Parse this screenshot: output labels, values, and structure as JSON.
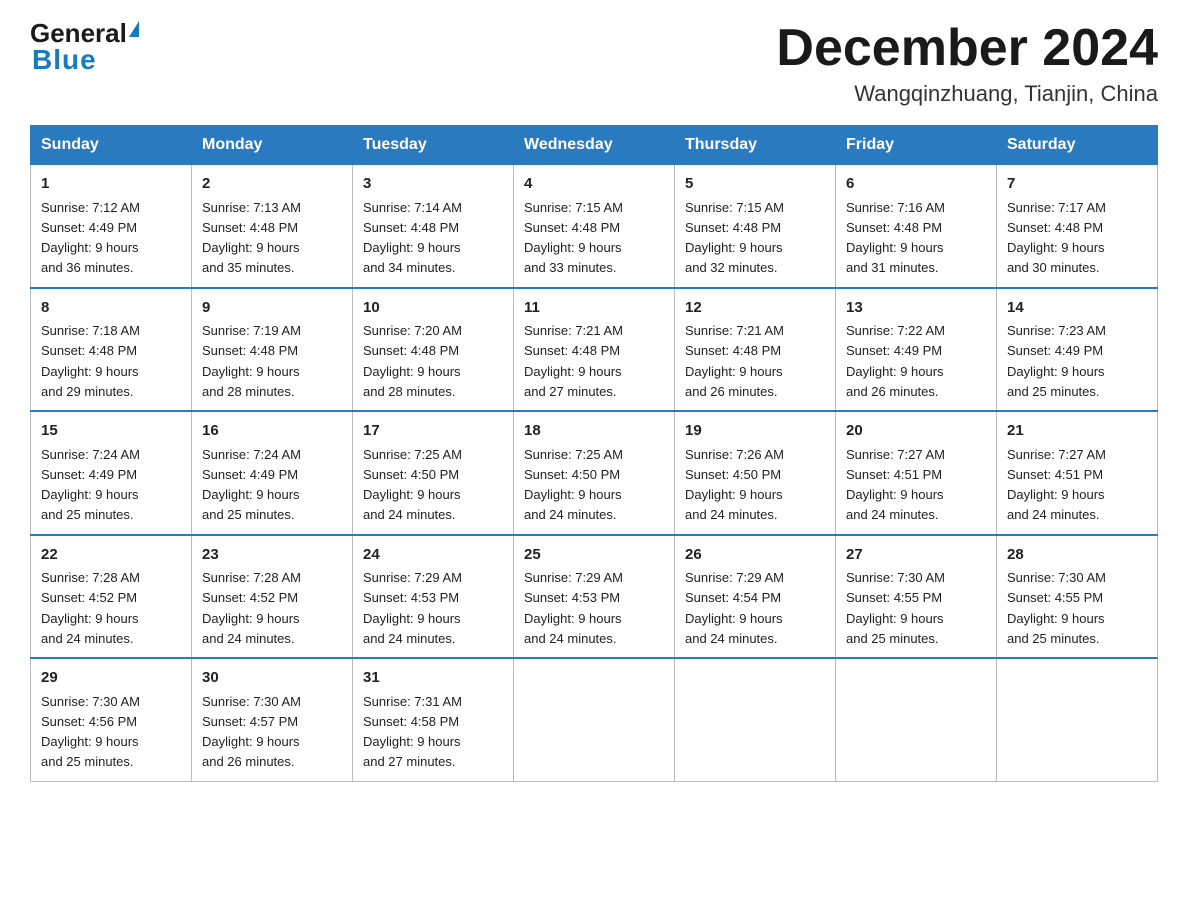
{
  "logo": {
    "general": "General",
    "triangle": "▶",
    "blue": "Blue"
  },
  "title": {
    "month": "December 2024",
    "location": "Wangqinzhuang, Tianjin, China"
  },
  "weekdays": [
    "Sunday",
    "Monday",
    "Tuesday",
    "Wednesday",
    "Thursday",
    "Friday",
    "Saturday"
  ],
  "weeks": [
    [
      {
        "day": "1",
        "sunrise": "7:12 AM",
        "sunset": "4:49 PM",
        "daylight": "9 hours and 36 minutes."
      },
      {
        "day": "2",
        "sunrise": "7:13 AM",
        "sunset": "4:48 PM",
        "daylight": "9 hours and 35 minutes."
      },
      {
        "day": "3",
        "sunrise": "7:14 AM",
        "sunset": "4:48 PM",
        "daylight": "9 hours and 34 minutes."
      },
      {
        "day": "4",
        "sunrise": "7:15 AM",
        "sunset": "4:48 PM",
        "daylight": "9 hours and 33 minutes."
      },
      {
        "day": "5",
        "sunrise": "7:15 AM",
        "sunset": "4:48 PM",
        "daylight": "9 hours and 32 minutes."
      },
      {
        "day": "6",
        "sunrise": "7:16 AM",
        "sunset": "4:48 PM",
        "daylight": "9 hours and 31 minutes."
      },
      {
        "day": "7",
        "sunrise": "7:17 AM",
        "sunset": "4:48 PM",
        "daylight": "9 hours and 30 minutes."
      }
    ],
    [
      {
        "day": "8",
        "sunrise": "7:18 AM",
        "sunset": "4:48 PM",
        "daylight": "9 hours and 29 minutes."
      },
      {
        "day": "9",
        "sunrise": "7:19 AM",
        "sunset": "4:48 PM",
        "daylight": "9 hours and 28 minutes."
      },
      {
        "day": "10",
        "sunrise": "7:20 AM",
        "sunset": "4:48 PM",
        "daylight": "9 hours and 28 minutes."
      },
      {
        "day": "11",
        "sunrise": "7:21 AM",
        "sunset": "4:48 PM",
        "daylight": "9 hours and 27 minutes."
      },
      {
        "day": "12",
        "sunrise": "7:21 AM",
        "sunset": "4:48 PM",
        "daylight": "9 hours and 26 minutes."
      },
      {
        "day": "13",
        "sunrise": "7:22 AM",
        "sunset": "4:49 PM",
        "daylight": "9 hours and 26 minutes."
      },
      {
        "day": "14",
        "sunrise": "7:23 AM",
        "sunset": "4:49 PM",
        "daylight": "9 hours and 25 minutes."
      }
    ],
    [
      {
        "day": "15",
        "sunrise": "7:24 AM",
        "sunset": "4:49 PM",
        "daylight": "9 hours and 25 minutes."
      },
      {
        "day": "16",
        "sunrise": "7:24 AM",
        "sunset": "4:49 PM",
        "daylight": "9 hours and 25 minutes."
      },
      {
        "day": "17",
        "sunrise": "7:25 AM",
        "sunset": "4:50 PM",
        "daylight": "9 hours and 24 minutes."
      },
      {
        "day": "18",
        "sunrise": "7:25 AM",
        "sunset": "4:50 PM",
        "daylight": "9 hours and 24 minutes."
      },
      {
        "day": "19",
        "sunrise": "7:26 AM",
        "sunset": "4:50 PM",
        "daylight": "9 hours and 24 minutes."
      },
      {
        "day": "20",
        "sunrise": "7:27 AM",
        "sunset": "4:51 PM",
        "daylight": "9 hours and 24 minutes."
      },
      {
        "day": "21",
        "sunrise": "7:27 AM",
        "sunset": "4:51 PM",
        "daylight": "9 hours and 24 minutes."
      }
    ],
    [
      {
        "day": "22",
        "sunrise": "7:28 AM",
        "sunset": "4:52 PM",
        "daylight": "9 hours and 24 minutes."
      },
      {
        "day": "23",
        "sunrise": "7:28 AM",
        "sunset": "4:52 PM",
        "daylight": "9 hours and 24 minutes."
      },
      {
        "day": "24",
        "sunrise": "7:29 AM",
        "sunset": "4:53 PM",
        "daylight": "9 hours and 24 minutes."
      },
      {
        "day": "25",
        "sunrise": "7:29 AM",
        "sunset": "4:53 PM",
        "daylight": "9 hours and 24 minutes."
      },
      {
        "day": "26",
        "sunrise": "7:29 AM",
        "sunset": "4:54 PM",
        "daylight": "9 hours and 24 minutes."
      },
      {
        "day": "27",
        "sunrise": "7:30 AM",
        "sunset": "4:55 PM",
        "daylight": "9 hours and 25 minutes."
      },
      {
        "day": "28",
        "sunrise": "7:30 AM",
        "sunset": "4:55 PM",
        "daylight": "9 hours and 25 minutes."
      }
    ],
    [
      {
        "day": "29",
        "sunrise": "7:30 AM",
        "sunset": "4:56 PM",
        "daylight": "9 hours and 25 minutes."
      },
      {
        "day": "30",
        "sunrise": "7:30 AM",
        "sunset": "4:57 PM",
        "daylight": "9 hours and 26 minutes."
      },
      {
        "day": "31",
        "sunrise": "7:31 AM",
        "sunset": "4:58 PM",
        "daylight": "9 hours and 27 minutes."
      },
      null,
      null,
      null,
      null
    ]
  ],
  "labels": {
    "sunrise": "Sunrise:",
    "sunset": "Sunset:",
    "daylight": "Daylight:"
  }
}
